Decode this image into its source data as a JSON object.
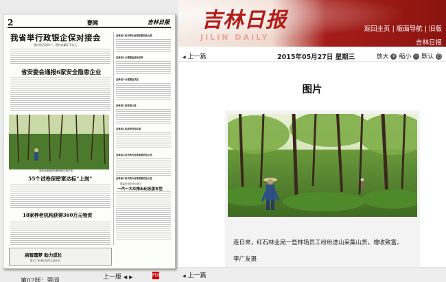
{
  "newspaper_thumb": {
    "page_number": "2",
    "section": "要闻",
    "masthead": "吉林日报",
    "headline_main": "我省举行政银企保对接会",
    "headline_main_sub": "签约项目360个，签约金额572亿元",
    "headline_second": "省安委会通报6家安全隐患企业",
    "headline_third_kicker": "我省全面推进化解钢铁过剩产能",
    "headline_third": "55个试卷保密室达标\"上岗\"",
    "headline_fourth": "18家养老机构获得360万元物资",
    "headline_fifth_kicker": "提高司法机关公信力",
    "headline_fifth": "一汽一大众推出纪念版车型",
    "ad_line1": "启智圆梦  助力成长",
    "ad_line2": "童心广场·爱心助学公益行动",
    "column_titles": [
      "吉林省人民代表大会常务委员会公告",
      "吉林省人大常委会任免名单",
      "吉林省人大常委会决定",
      "吉林省人民政府公告",
      "吉林省人民政府任免名单",
      "吉林省人民代表大会常务委员会公告",
      "吉林省人民代表大会常务委员会公告"
    ]
  },
  "left_footer": {
    "prev_label": "上一版",
    "page_label": "第02版：要闻"
  },
  "header": {
    "logo_cn": "吉林日报",
    "logo_en": "JILIN DAILY",
    "nav": [
      "返回主页",
      "版面导航",
      "旧版"
    ],
    "site_name": "吉林日报"
  },
  "toolbar": {
    "prev_label": "上一篇",
    "date": "2015年05月27日 星期三",
    "zoom_in": "放大",
    "zoom_out": "缩小",
    "default": "默认"
  },
  "article": {
    "title": "图片",
    "caption": "连日来，红石林业局一些林场员工纷纷进山采集山货，增收致富。",
    "author": "李广友摄"
  },
  "bottom": {
    "prev_label": "上一篇"
  },
  "colors": {
    "brand_red": "#b01c17",
    "banner_dark": "#8c1410",
    "forest_green": "#4e7a2e"
  }
}
